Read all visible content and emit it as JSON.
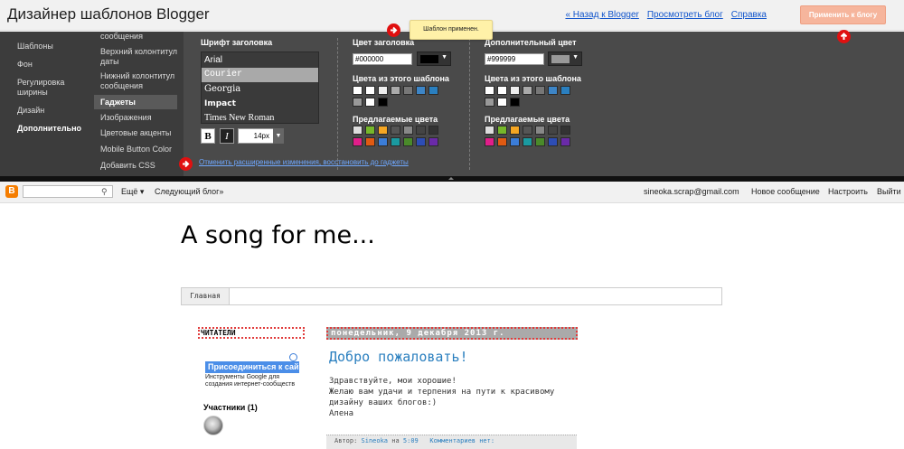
{
  "header": {
    "title": "Дизайнер шаблонов Blogger",
    "links": [
      "« Назад к Blogger",
      "Просмотреть блог",
      "Справка"
    ],
    "apply_label": "Применить к блогу"
  },
  "toast": "Шаблон применен.",
  "nav_primary": [
    "Шаблоны",
    "Фон",
    "Регулировка ширины",
    "Дизайн",
    "Дополнительно"
  ],
  "nav_secondary": [
    "сообщения",
    "Верхний колонтитул даты",
    "Нижний колонтитул сообщения",
    "Гаджеты",
    "Изображения",
    "Цветовые акценты",
    "Mobile Button Color",
    "Добавить CSS"
  ],
  "font_panel": {
    "label": "Шрифт заголовка",
    "fonts": [
      "Arial",
      "Courier",
      "Georgia",
      "Impact",
      "Times New Roman"
    ],
    "selected": "Courier",
    "bold_label": "B",
    "italic_label": "I",
    "size": "14px"
  },
  "title_color": {
    "label": "Цвет заголовка",
    "value": "#000000",
    "swatch": "#000000"
  },
  "extra_color": {
    "label": "Дополнительный цвет",
    "value": "#999999",
    "swatch": "#999999"
  },
  "template_colors_label": "Цвета из этого шаблона",
  "suggested_colors_label": "Предлагаемые цвета",
  "template_colors_title": [
    "#ffffff",
    "#ffffff",
    "#eeeeee",
    "#aaaaaa",
    "#777777",
    "#3d85c6",
    "#2a7fbf",
    "#999999",
    "#ffffff",
    "#000000"
  ],
  "suggested_colors_title": [
    "#dddddd",
    "#76b82a",
    "#f5a623",
    "#555555",
    "#888888",
    "#444444",
    "#333333",
    "#e11e8a",
    "#e05a12",
    "#3b7dd8",
    "#1a9aa0",
    "#4a8a2a",
    "#2d4db5",
    "#6a2aa8"
  ],
  "template_colors_extra": [
    "#ffffff",
    "#ffffff",
    "#eeeeee",
    "#aaaaaa",
    "#777777",
    "#3d85c6",
    "#2a7fbf",
    "#999999",
    "#ffffff",
    "#000000"
  ],
  "suggested_colors_extra": [
    "#dddddd",
    "#76b82a",
    "#f5a623",
    "#555555",
    "#888888",
    "#444444",
    "#333333",
    "#e11e8a",
    "#e05a12",
    "#3b7dd8",
    "#1a9aa0",
    "#4a8a2a",
    "#2d4db5",
    "#6a2aa8"
  ],
  "revert_link": "Отменить расширенные изменения, восстановить до гаджеты",
  "navbar": {
    "logo": "B",
    "more": "Ещё ▾",
    "next_blog": "Следующий блог»",
    "email": "sineoka.scrap@gmail.com",
    "new_post": "Новое сообщение",
    "settings": "Настроить",
    "logout": "Выйти"
  },
  "blog": {
    "title": "A song for me...",
    "home_tab": "Главная",
    "readers_title": "ЧИТАТЕЛИ",
    "date": "понедельник, 9 декабря 2013 г.",
    "join": "Присоединиться к сайту",
    "gfc_desc": "Инструменты Google для создания интернет-сообществ",
    "members": "Участники (1)",
    "post_title": "Добро пожаловать!",
    "post_lines": [
      "Здравствуйте, мои хорошие!",
      "Желаю вам удачи и терпения на пути к красивому дизайну ваших блогов:)",
      "Алена"
    ],
    "footer_author_label": "Автор:",
    "footer_author": "Sineoka",
    "footer_on": "на",
    "footer_time": "5:09",
    "footer_comments": "Комментариев нет:"
  },
  "colors": {
    "accent_red": "#e01010",
    "link_blue": "#15c",
    "panel_bg": "#4a4a4a"
  }
}
